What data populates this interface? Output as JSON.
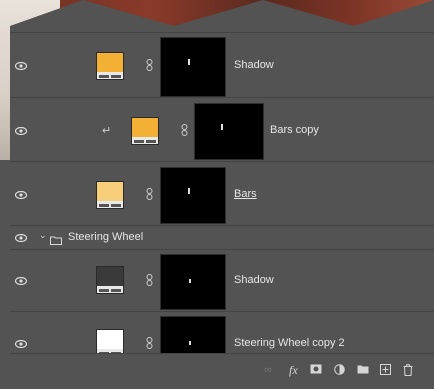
{
  "layers": [
    {
      "id": "shadow-1",
      "name": "Shadow",
      "swatch_color": "#f2b134",
      "underline": false
    },
    {
      "id": "bars-copy",
      "name": "Bars copy",
      "swatch_color": "#f2b134",
      "underline": false
    },
    {
      "id": "bars",
      "name": "Bars",
      "swatch_color": "#f7cf7a",
      "underline": true
    },
    {
      "id": "steering-wheel-group",
      "name": "Steering Wheel"
    },
    {
      "id": "shadow-2",
      "name": "Shadow",
      "swatch_color": "#3a3a3a",
      "underline": false
    },
    {
      "id": "steering-wheel-copy-2",
      "name": "Steering Wheel copy 2",
      "swatch_color": "#ffffff",
      "underline": false
    }
  ],
  "footer": {
    "fx_label": "fx"
  }
}
